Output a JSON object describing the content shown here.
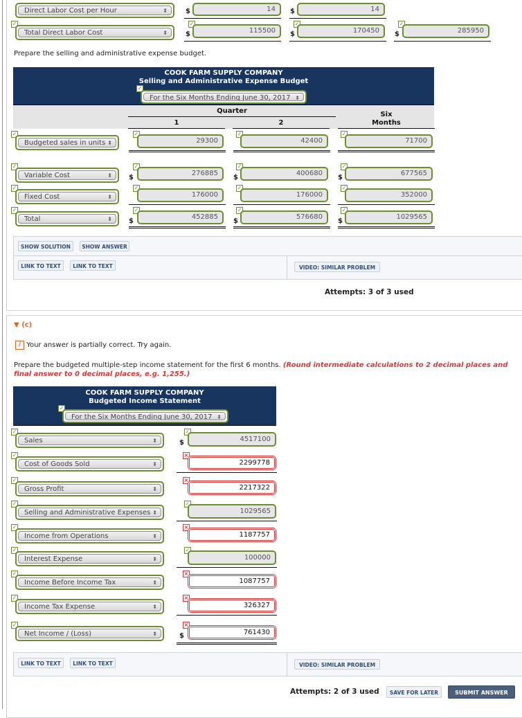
{
  "part_b_top": {
    "rows": [
      {
        "label": "Direct Labor Cost per Hour",
        "q1": "14",
        "q2": "14",
        "six": ""
      },
      {
        "label": "Total Direct Labor Cost",
        "q1": "115500",
        "q2": "170450",
        "six": "285950"
      }
    ],
    "currency": "$"
  },
  "sa_budget": {
    "instruction": "Prepare the selling and administrative expense budget.",
    "company": "COOK FARM SUPPLY COMPANY",
    "title": "Selling and Administrative Expense Budget",
    "period": "For the Six Months Ending June 30, 2017",
    "col_group": "Quarter",
    "col1": "1",
    "col2": "2",
    "col3_line1": "Six",
    "col3_line2": "Months",
    "rows": [
      {
        "label": "Budgeted sales in units",
        "q1": "29300",
        "q2": "42400",
        "six": "71700"
      },
      {
        "label": "Variable Cost",
        "q1": "276885",
        "q2": "400680",
        "six": "677565"
      },
      {
        "label": "Fixed Cost",
        "q1": "176000",
        "q2": "176000",
        "six": "352000"
      },
      {
        "label": "Total",
        "q1": "452885",
        "q2": "576680",
        "six": "1029565"
      }
    ],
    "buttons": {
      "show_solution": "SHOW SOLUTION",
      "show_answer": "SHOW ANSWER",
      "link1": "LINK TO TEXT",
      "link2": "LINK TO TEXT",
      "video": "VIDEO: SIMILAR PROBLEM"
    },
    "attempts": "Attempts: 3 of 3 used"
  },
  "part_c": {
    "label": "(c)",
    "feedback": "Your answer is partially correct.  Try again.",
    "instruction": "Prepare the budgeted multiple-step income statement for the first 6 months.",
    "instruction_note": "(Round intermediate calculations to 2 decimal places and final answer to 0 decimal places, e.g. 1,255.)",
    "company": "COOK FARM SUPPLY COMPANY",
    "title": "Budgeted Income Statement",
    "period": "For the Six Months Ending June 30, 2017",
    "rows": [
      {
        "label": "Sales",
        "value": "4517100",
        "status": "correct"
      },
      {
        "label": "Cost of Goods Sold",
        "value": "2299778",
        "status": "incorrect"
      },
      {
        "label": "Gross Profit",
        "value": "2217322",
        "status": "incorrect"
      },
      {
        "label": "Selling and Administrative Expenses",
        "value": "1029565",
        "status": "correct"
      },
      {
        "label": "Income from Operations",
        "value": "1187757",
        "status": "incorrect"
      },
      {
        "label": "Interest Expense",
        "value": "100000",
        "status": "correct"
      },
      {
        "label": "Income Before Income Tax",
        "value": "1087757",
        "status": "incorrect"
      },
      {
        "label": "Income Tax Expense",
        "value": "326327",
        "status": "incorrect"
      },
      {
        "label": "Net Income / (Loss)",
        "value": "761430",
        "status": "incorrect"
      }
    ],
    "buttons": {
      "link1": "LINK TO TEXT",
      "link2": "LINK TO TEXT",
      "video": "VIDEO: SIMILAR PROBLEM",
      "save": "SAVE FOR LATER",
      "submit": "SUBMIT ANSWER"
    },
    "attempts": "Attempts: 2 of 3 used"
  },
  "colors": {
    "correct": "#6b8e2f",
    "incorrect": "#d23a3a",
    "header": "#17355f",
    "note": "#d23a3a"
  }
}
